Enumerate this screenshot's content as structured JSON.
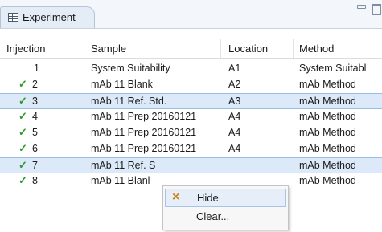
{
  "panel": {
    "tab_title": "Experiment"
  },
  "table": {
    "columns": [
      "Injection",
      "Sample",
      "Location",
      "Method"
    ],
    "rows": [
      {
        "check": "",
        "injection": "1",
        "sample": "System Suitability",
        "location": "A1",
        "method": "System Suitabl"
      },
      {
        "check": "✓",
        "injection": "2",
        "sample": "mAb 11 Blank",
        "location": "A2",
        "method": "mAb Method"
      },
      {
        "check": "✓",
        "injection": "3",
        "sample": "mAb 11 Ref. Std.",
        "location": "A3",
        "method": "mAb Method"
      },
      {
        "check": "✓",
        "injection": "4",
        "sample": "mAb 11 Prep 20160121",
        "location": "A4",
        "method": "mAb Method"
      },
      {
        "check": "✓",
        "injection": "5",
        "sample": "mAb 11 Prep 20160121",
        "location": "A4",
        "method": "mAb Method"
      },
      {
        "check": "✓",
        "injection": "6",
        "sample": "mAb 11 Prep 20160121",
        "location": "A4",
        "method": "mAb Method"
      },
      {
        "check": "✓",
        "injection": "7",
        "sample": "mAb 11 Ref. S",
        "location": "",
        "method": "mAb Method"
      },
      {
        "check": "✓",
        "injection": "8",
        "sample": "mAb 11 Blanl",
        "location": "",
        "method": "mAb Method"
      }
    ]
  },
  "context_menu": {
    "items": [
      {
        "icon": "×",
        "label": "Hide"
      },
      {
        "icon": "",
        "label": "Clear..."
      }
    ]
  },
  "colors": {
    "selection": "#dbe9f8",
    "check": "#2e9a2e",
    "hide_icon": "#c88512"
  }
}
